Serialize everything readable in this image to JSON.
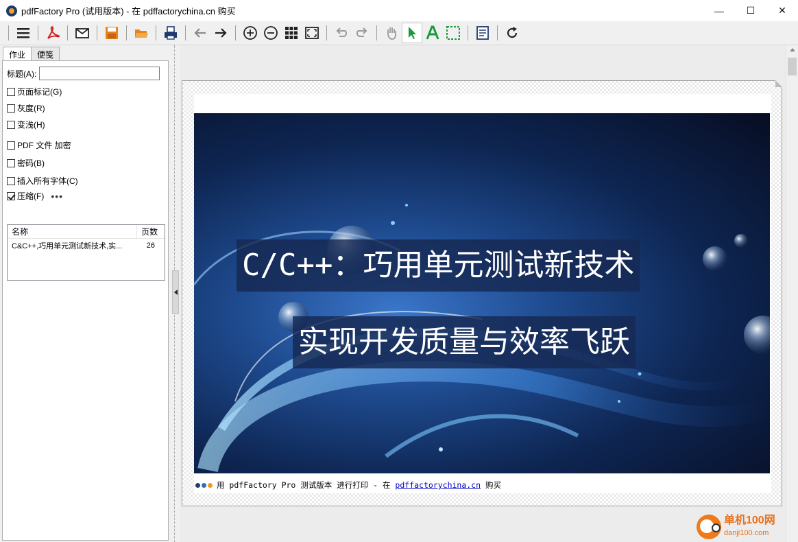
{
  "window": {
    "title": "pdfFactory Pro (试用版本) - 在 pdffactorychina.cn 购买",
    "controls": {
      "minimize": "—",
      "maximize": "☐",
      "close": "✕"
    }
  },
  "toolbar": {
    "buttons": [
      {
        "icon": "menu-icon"
      },
      {
        "icon": "pdf-icon"
      },
      {
        "icon": "email-icon"
      },
      {
        "icon": "save-icon"
      },
      {
        "icon": "open-folder-icon"
      },
      {
        "icon": "print-icon"
      },
      {
        "icon": "back-arrow-icon"
      },
      {
        "icon": "forward-arrow-icon"
      },
      {
        "icon": "zoom-in-icon"
      },
      {
        "icon": "zoom-out-icon"
      },
      {
        "icon": "grid-view-icon"
      },
      {
        "icon": "fit-page-icon"
      },
      {
        "icon": "undo-icon"
      },
      {
        "icon": "redo-icon"
      },
      {
        "icon": "hand-tool-icon"
      },
      {
        "icon": "select-arrow-icon"
      },
      {
        "icon": "text-tool-icon"
      },
      {
        "icon": "marquee-select-icon"
      },
      {
        "icon": "notes-icon"
      },
      {
        "icon": "refresh-icon"
      }
    ],
    "active": "select-arrow-icon"
  },
  "left_panel": {
    "tabs": [
      "作业",
      "便笺"
    ],
    "title_label": "标题(A):",
    "title_value": "",
    "options": {
      "page_marks": {
        "label": "页面标记(G)",
        "checked": false
      },
      "grayscale": {
        "label": "灰度(R)",
        "checked": false
      },
      "lighten": {
        "label": "变浅(H)",
        "checked": false
      },
      "encrypt": {
        "label": "PDF 文件 加密",
        "checked": false
      },
      "password": {
        "label": "密码(B)",
        "checked": false
      },
      "embed_fonts": {
        "label": "插入所有字体(C)",
        "checked": false
      },
      "compress": {
        "label": "压缩(F)",
        "checked": true,
        "more": "•••"
      }
    },
    "jobs": {
      "columns": [
        "名称",
        "页数"
      ],
      "rows": [
        {
          "name": "C&C++,巧用单元测试新技术,实...",
          "pages": "26"
        }
      ]
    }
  },
  "preview": {
    "headline_1": "C/C++：巧用单元测试新技术",
    "headline_2": "实现开发质量与效率飞跃",
    "footer_prefix": "用 pdfFactory Pro 测试版本 进行打印 - 在 ",
    "footer_link": "pdffactorychina.cn",
    "footer_suffix": " 购买",
    "footer_dot_colors": [
      "#1c3f7a",
      "#2f6fb8",
      "#f29a1e"
    ]
  },
  "watermark": {
    "name": "单机100网",
    "url": "danji100.com"
  },
  "colors": {
    "accent_green": "#1a9a3a",
    "pdf_red": "#d32020",
    "save_orange": "#e8821a"
  }
}
